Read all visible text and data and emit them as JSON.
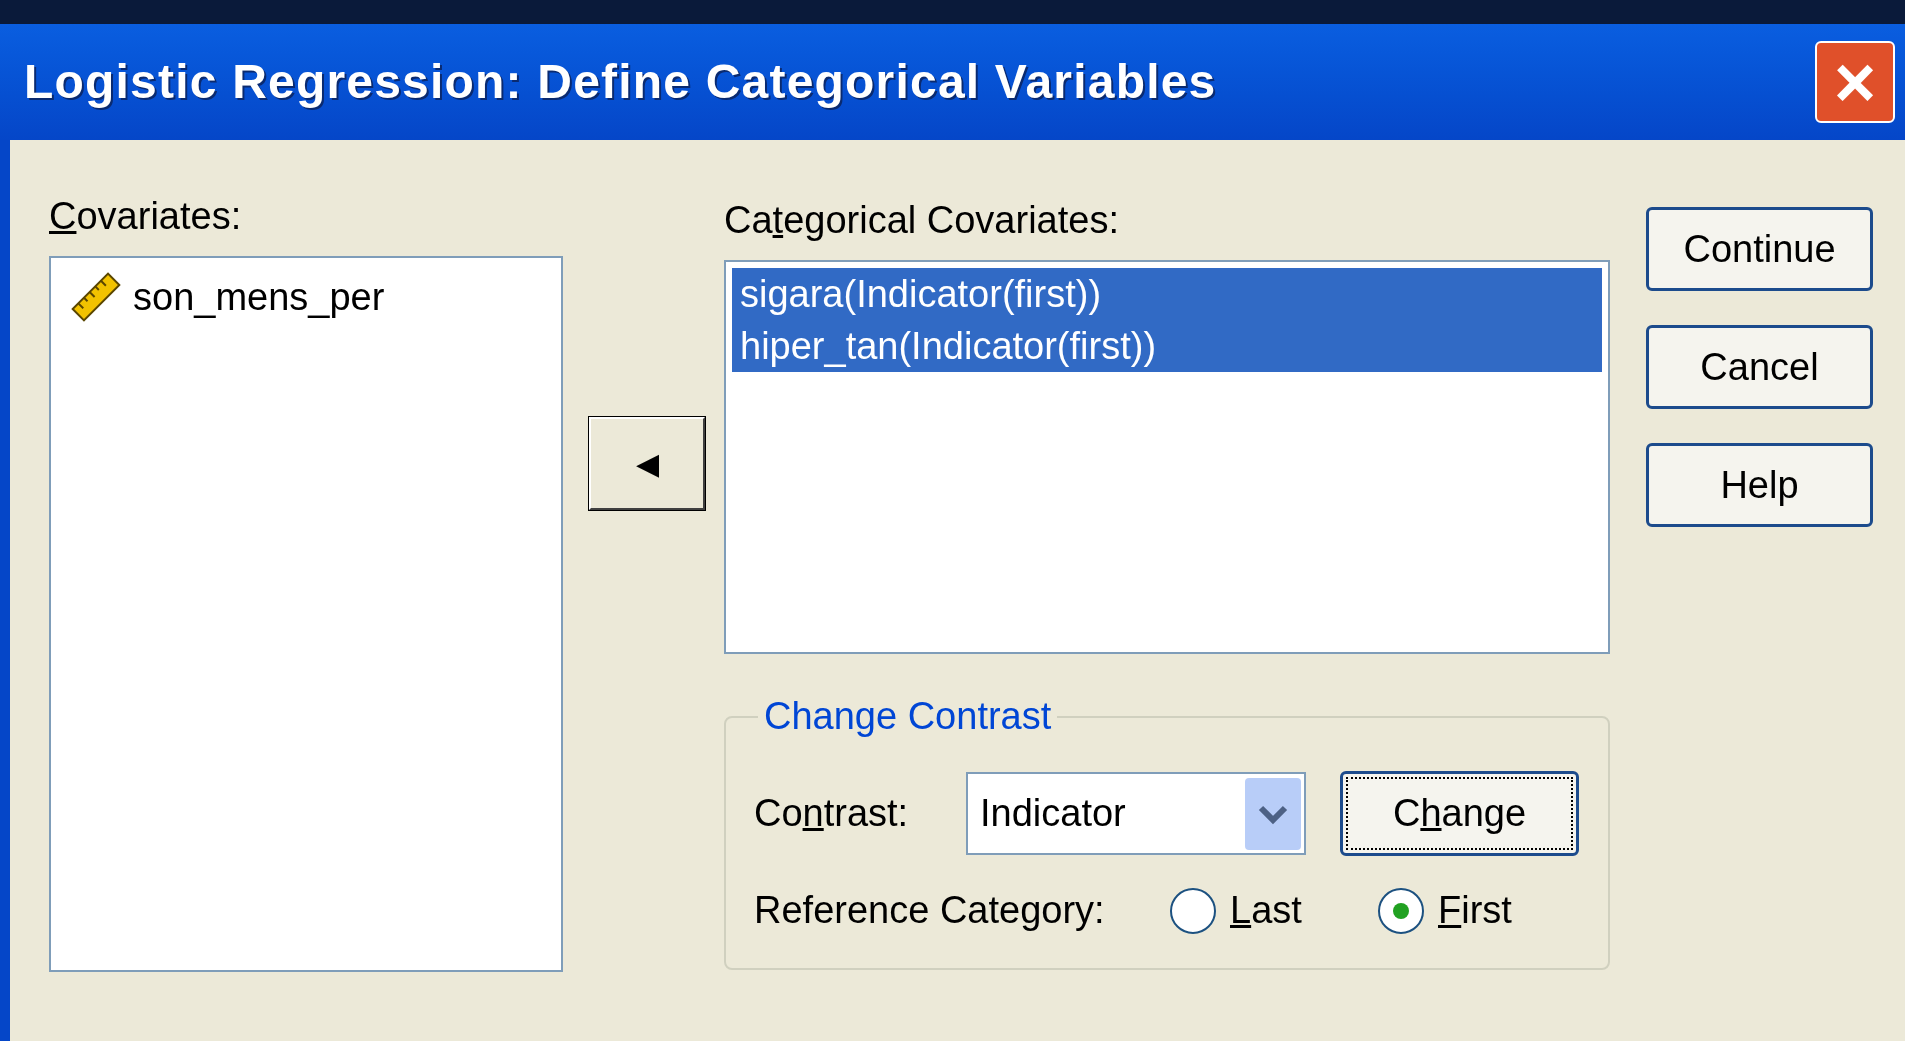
{
  "window": {
    "title": "Logistic Regression: Define Categorical Variables",
    "close": "×"
  },
  "covariates": {
    "label": [
      {
        "text": "C",
        "underlined": true
      },
      {
        "text": "ovariates:",
        "underlined": false
      }
    ],
    "items": [
      {
        "name": "son_mens_per",
        "selected": false
      }
    ]
  },
  "move_button": {
    "glyph": "◀"
  },
  "categorical": {
    "label": [
      {
        "text": "Ca",
        "underlined": false
      },
      {
        "text": "t",
        "underlined": true
      },
      {
        "text": "egorical Covariates:",
        "underlined": false
      }
    ],
    "items": [
      {
        "name": "sigara(Indicator(first))",
        "selected": true
      },
      {
        "name": "hiper_tan(Indicator(first))",
        "selected": true
      }
    ]
  },
  "change_contrast": {
    "title": "Change Contrast",
    "contrast_label": [
      {
        "text": "Co",
        "underlined": false
      },
      {
        "text": "n",
        "underlined": true
      },
      {
        "text": "trast:",
        "underlined": false
      }
    ],
    "contrast_value": "Indicator",
    "change_button": [
      {
        "text": "C",
        "underlined": false
      },
      {
        "text": "h",
        "underlined": true
      },
      {
        "text": "ange",
        "underlined": false
      }
    ],
    "reference_label": "Reference Category:",
    "options": [
      {
        "label": [
          {
            "text": "L",
            "underlined": true
          },
          {
            "text": "ast",
            "underlined": false
          }
        ],
        "selected": false
      },
      {
        "label": [
          {
            "text": "F",
            "underlined": true
          },
          {
            "text": "irst",
            "underlined": false
          }
        ],
        "selected": true
      }
    ]
  },
  "buttons": [
    "Continue",
    "Cancel",
    "Help"
  ]
}
